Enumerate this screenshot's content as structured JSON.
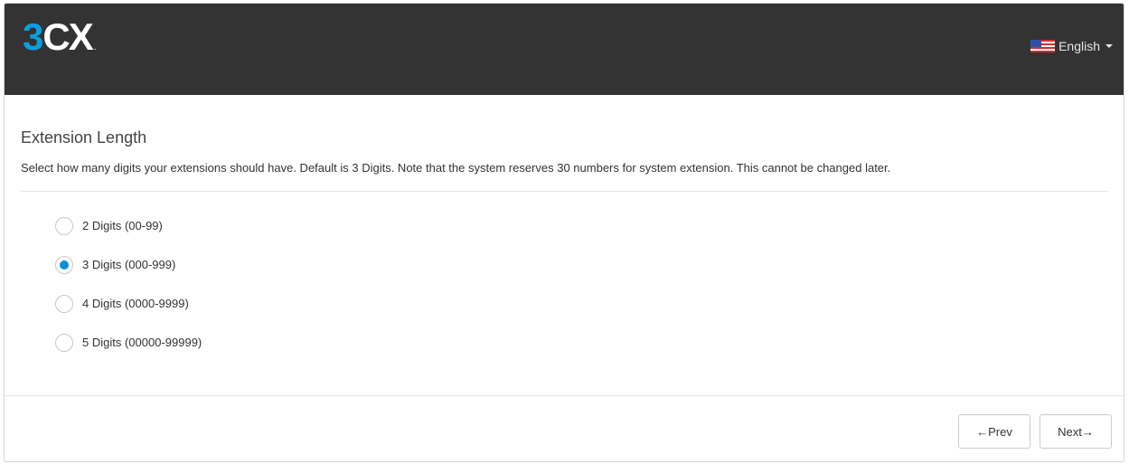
{
  "header": {
    "logo_three": "3",
    "logo_cx": "CX",
    "logo_dot": ".",
    "language": "English"
  },
  "section": {
    "title": "Extension Length",
    "description": "Select how many digits your extensions should have. Default is 3 Digits. Note that the system reserves 30 numbers for system extension. This cannot be changed later."
  },
  "options": [
    {
      "label": "2 Digits (00-99)",
      "checked": false
    },
    {
      "label": "3 Digits (000-999)",
      "checked": true
    },
    {
      "label": "4 Digits (0000-9999)",
      "checked": false
    },
    {
      "label": "5 Digits (00000-99999)",
      "checked": false
    }
  ],
  "footer": {
    "prev_label": "←Prev",
    "next_label": "Next→"
  },
  "colors": {
    "header_bg": "#333333",
    "brand_blue": "#0b9fe0",
    "radio_selected": "#0b8fd8"
  },
  "icons": {
    "flag": "us-flag-icon",
    "dropdown": "caret-down-icon"
  }
}
